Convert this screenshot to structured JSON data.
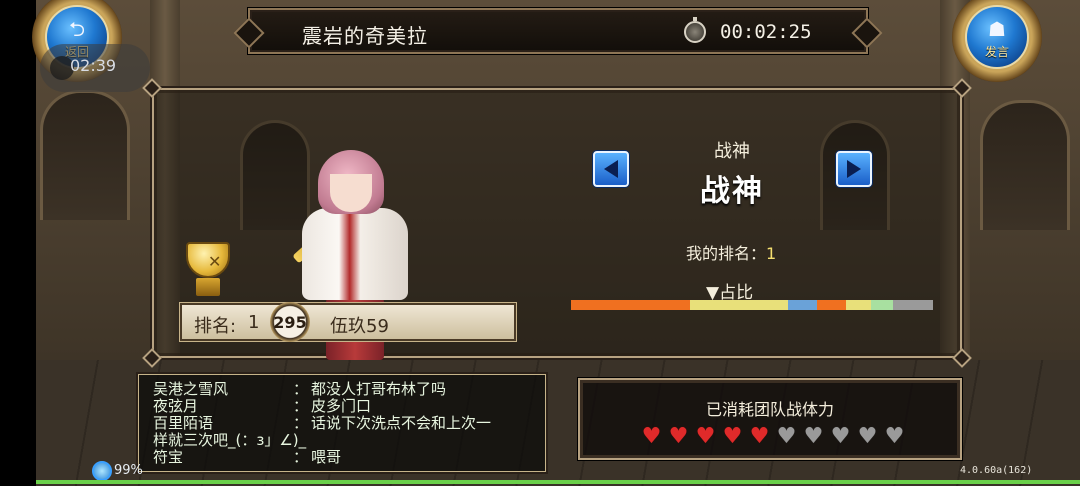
{
  "header": {
    "map_name": "震岩的奇美拉",
    "timer": "00:02:25",
    "timer_icon": "stopwatch-icon"
  },
  "corners": {
    "back_label": "返回",
    "back_icon": "return-arrow-icon",
    "clock_overlay": "02:39",
    "chat_label": "发言",
    "chat_icon": "megaphone-icon"
  },
  "ranking": {
    "class_small": "战神",
    "class_big": "战神",
    "my_rank_label": "我的排名：",
    "my_rank_value": "1",
    "share_label": "▼占比",
    "share_segments": [
      {
        "fraction": 0.33,
        "color": "#f07020"
      },
      {
        "fraction": 0.27,
        "color": "#e8e07a"
      },
      {
        "fraction": 0.08,
        "color": "#6aa2d8"
      },
      {
        "fraction": 0.08,
        "color": "#f07020"
      },
      {
        "fraction": 0.07,
        "color": "#e8e07a"
      },
      {
        "fraction": 0.06,
        "color": "#a8e0a0"
      },
      {
        "fraction": 0.11,
        "color": "#9a9a9a"
      }
    ],
    "player": {
      "rank_label": "排名:",
      "rank_value": "1",
      "level": "295",
      "name": "伍玖59"
    }
  },
  "chat": {
    "messages": [
      {
        "sender": "吴港之雪风",
        "sep": "：",
        "text": "都没人打哥布林了吗"
      },
      {
        "sender": "夜弦月",
        "sep": "：",
        "text": "皮多门口"
      },
      {
        "sender": "百里陌语",
        "sep": "：",
        "text": "话说下次洗点不会和上次一"
      },
      {
        "sender": "样就三次吧_(：з」∠)_",
        "sep": "",
        "text": ""
      },
      {
        "sender": "符宝",
        "sep": "：",
        "text": "喂哥"
      }
    ]
  },
  "stamina": {
    "title": "已消耗团队战体力",
    "used": 5,
    "total": 10
  },
  "status": {
    "battery": "99%",
    "version": "4.0.60a(162)",
    "progress": 1.0
  }
}
